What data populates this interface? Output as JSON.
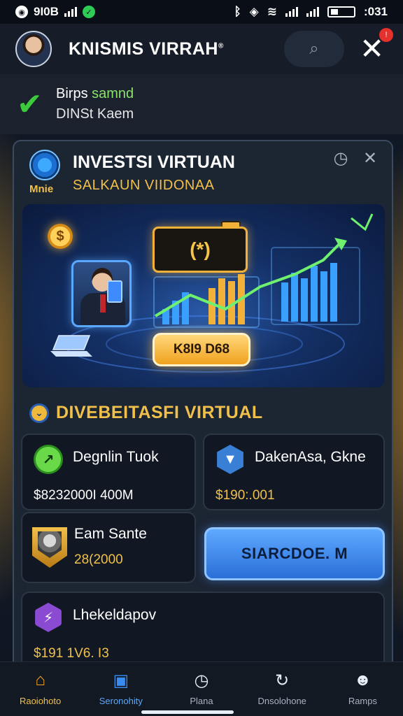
{
  "status_bar": {
    "carrier": "9I0B",
    "time": ":031",
    "left_icons": [
      "app-icon",
      "signal-icon",
      "shield-check-icon"
    ],
    "right_icons": [
      "bluetooth-icon",
      "nfc-icon",
      "wifi-icon",
      "signal-icon",
      "signal-icon",
      "battery-icon"
    ]
  },
  "header": {
    "title": "KNISMIS VIRRAH",
    "title_mark": "®",
    "badge": "!"
  },
  "notice": {
    "line1_prefix": "Birps",
    "line1_highlight": "samnd",
    "line2": "DINSt Kaem"
  },
  "panel": {
    "brand_tag": "Mnie",
    "title": "INVESTSI VIRTUAN",
    "subtitle": "SALKAUN VIIDONAA",
    "hero": {
      "coin_symbol": "$",
      "screen_symbol": "(*)",
      "button_label": "K8I9 D68"
    },
    "section_title": "DIVEBEITASFI VIRTUAL",
    "cards": [
      {
        "name": "Degnlin Tuok",
        "value": "$8232000I 400M",
        "icon": "green-chart-icon"
      },
      {
        "name": "DakenAsa, Gkne",
        "value": "$190:.001",
        "icon": "blue-shield-icon"
      },
      {
        "name": "Eam Sante",
        "value": "28(2000",
        "icon": "portrait-badge-icon"
      },
      {
        "name": "Lhekeldapov",
        "value": "$191 1V6. I3",
        "icon": "purple-hex-icon"
      }
    ],
    "action_button": "SIARCDOE. M"
  },
  "bottom_nav": [
    {
      "label": "Raoiohoto",
      "icon": "home-icon",
      "state": "active"
    },
    {
      "label": "Seronohity",
      "icon": "stack-icon",
      "state": "blue"
    },
    {
      "label": "Plana",
      "icon": "clock-icon",
      "state": "normal"
    },
    {
      "label": "Dnsolohone",
      "icon": "refresh-icon",
      "state": "normal"
    },
    {
      "label": "Ramps",
      "icon": "profile-icon",
      "state": "normal"
    }
  ],
  "colors": {
    "accent_gold": "#f1c04a",
    "accent_blue": "#3a8bf0",
    "success_green": "#3cc93c",
    "background": "#131c2b"
  }
}
